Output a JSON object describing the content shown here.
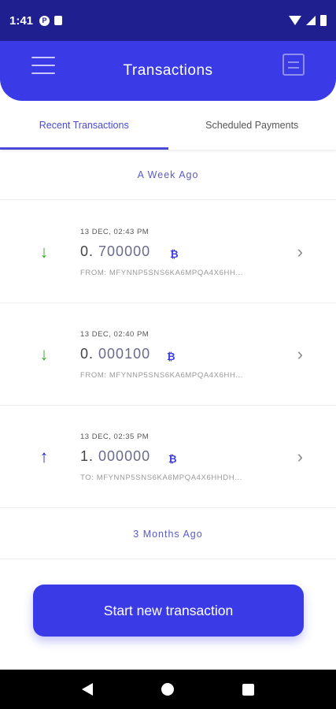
{
  "status_bar": {
    "time": "1:41",
    "circle_icon_letter": "P"
  },
  "app_bar": {
    "title": "Transactions"
  },
  "tabs": [
    {
      "label": "Recent Transactions",
      "active": true
    },
    {
      "label": "Scheduled Payments",
      "active": false
    }
  ],
  "sections": [
    {
      "label": "A Week Ago"
    },
    {
      "label": "3 Months Ago"
    }
  ],
  "transactions": [
    {
      "direction": "incoming",
      "arrow": "↓",
      "date": "13 DEC, 02:43 PM",
      "amount_int": "0.",
      "amount_dec": "700000",
      "coin_glyph": "₿",
      "address": "FROM: MFYNNP5SNS6KA6MPQA4X6HH..."
    },
    {
      "direction": "incoming",
      "arrow": "↓",
      "date": "13 DEC, 02:40 PM",
      "amount_int": "0.",
      "amount_dec": "000100",
      "coin_glyph": "₿",
      "address": "FROM: MFYNNP5SNS6KA6MPQA4X6HH..."
    },
    {
      "direction": "outgoing",
      "arrow": "↑",
      "date": "13 DEC, 02:35 PM",
      "amount_int": "1.",
      "amount_dec": "000000",
      "coin_glyph": "₿",
      "address": "TO: MFYNNP5SNS6KA6MPQA4X6HHDH..."
    }
  ],
  "chevron": "›",
  "cta": {
    "label": "Start new transaction"
  },
  "colors": {
    "primary": "#3a3ae6",
    "status_bar": "#1f1f8f",
    "incoming": "#37a829",
    "outgoing": "#2a2ad0"
  },
  "icons": {
    "menu": "hamburger-icon",
    "filter": "filter-list-icon",
    "incoming": "arrow-down-icon",
    "outgoing": "arrow-up-icon",
    "coin": "coin-icon",
    "chevron": "chevron-right-icon"
  }
}
